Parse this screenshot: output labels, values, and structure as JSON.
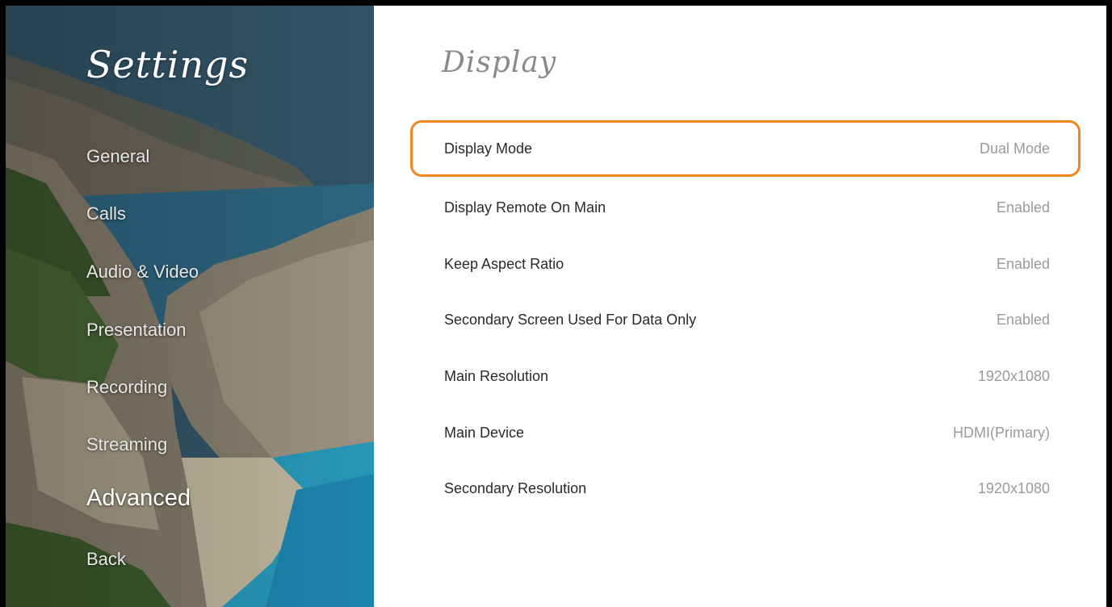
{
  "sidebar": {
    "title": "Settings",
    "items": [
      {
        "label": "General"
      },
      {
        "label": "Calls"
      },
      {
        "label": "Audio & Video"
      },
      {
        "label": "Presentation"
      },
      {
        "label": "Recording"
      },
      {
        "label": "Streaming"
      },
      {
        "label": "Advanced",
        "active": true
      },
      {
        "label": "Back"
      }
    ]
  },
  "main": {
    "title": "Display",
    "settings": [
      {
        "label": "Display Mode",
        "value": "Dual Mode",
        "focused": true
      },
      {
        "label": "Display Remote On Main",
        "value": "Enabled"
      },
      {
        "label": "Keep Aspect Ratio",
        "value": "Enabled"
      },
      {
        "label": "Secondary Screen Used For Data Only",
        "value": "Enabled"
      },
      {
        "label": "Main Resolution",
        "value": "1920x1080"
      },
      {
        "label": "Main Device",
        "value": "HDMI(Primary)"
      },
      {
        "label": "Secondary Resolution",
        "value": "1920x1080"
      }
    ]
  },
  "colors": {
    "focus_border": "#f0861e",
    "label_text": "#2a2a2a",
    "value_text": "#9a9a9a",
    "title_text": "#8a8a8a"
  }
}
